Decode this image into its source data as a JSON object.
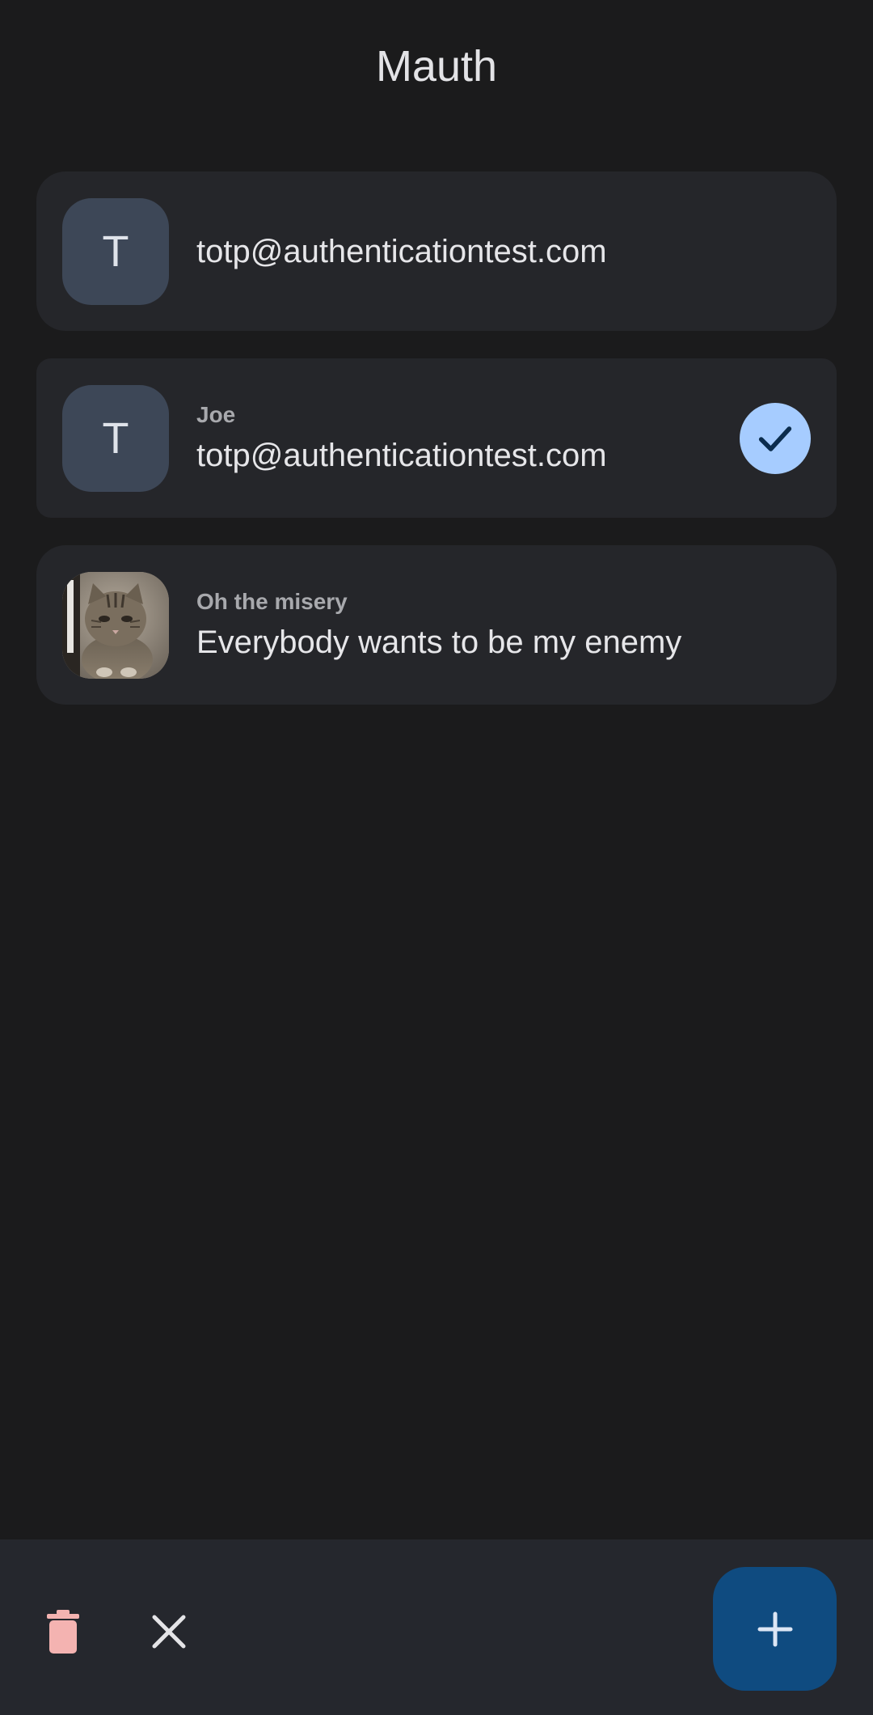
{
  "app": {
    "title": "Mauth"
  },
  "accounts": [
    {
      "avatar_letter": "T",
      "issuer": "",
      "name": "totp@authenticationtest.com",
      "selected": false
    },
    {
      "avatar_letter": "T",
      "issuer": "Joe",
      "name": "totp@authenticationtest.com",
      "selected": true
    },
    {
      "avatar_image": "cat-photo",
      "issuer": "Oh the misery",
      "name": "Everybody wants to be my enemy",
      "selected": false
    }
  ],
  "bottom_bar": {
    "delete_icon": "trash-icon",
    "close_icon": "close-icon",
    "add_icon": "plus-icon"
  },
  "colors": {
    "background": "#1b1b1c",
    "card": "#25262a",
    "avatar": "#3d4757",
    "accent_light": "#a6ccff",
    "fab": "#0f4b80",
    "delete": "#f4b3b1"
  }
}
